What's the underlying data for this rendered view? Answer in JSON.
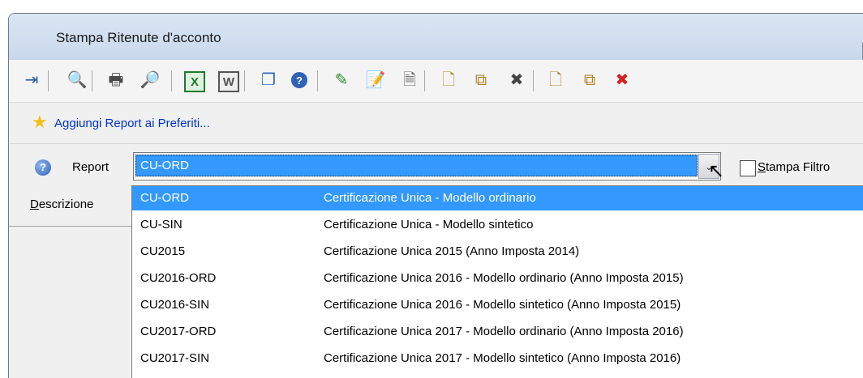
{
  "window": {
    "title": "Stampa Ritenute d'acconto"
  },
  "toolbar": {
    "buttons": [
      {
        "icon": "exit-icon",
        "glyph": "⇥",
        "color": "#2c5fa8"
      },
      {
        "icon": "binoculars-icon",
        "glyph": "🔍",
        "color": "#333333"
      },
      {
        "icon": "print-icon",
        "glyph": "🖶",
        "color": "#4a4a4a"
      },
      {
        "icon": "print-preview-icon",
        "glyph": "🔎",
        "color": "#2d5fa0"
      },
      {
        "icon": "excel-icon",
        "glyph": "X",
        "color": "#1d7a2e"
      },
      {
        "icon": "word-icon",
        "glyph": "W",
        "color": "#555555"
      },
      {
        "icon": "windows-icon",
        "glyph": "❐",
        "color": "#2f6bc4"
      },
      {
        "icon": "help-icon",
        "glyph": "?",
        "color": "#2f62b8"
      },
      {
        "icon": "pencil-icon",
        "glyph": "✎",
        "color": "#2e8b2e"
      },
      {
        "icon": "edit-document-icon",
        "glyph": "📝",
        "color": "#3b7a2f"
      },
      {
        "icon": "document-icon",
        "glyph": "🗎",
        "color": "#666666"
      },
      {
        "icon": "new-icon",
        "glyph": "🗋",
        "color": "#b08a2e"
      },
      {
        "icon": "copy-icon",
        "glyph": "⧉",
        "color": "#b07a1e"
      },
      {
        "icon": "delete-gray-icon",
        "glyph": "✖",
        "color": "#444444"
      },
      {
        "icon": "new-icon-2",
        "glyph": "🗋",
        "color": "#b08a2e"
      },
      {
        "icon": "copy-icon-2",
        "glyph": "⧉",
        "color": "#b07a1e"
      },
      {
        "icon": "delete-red-icon",
        "glyph": "✖",
        "color": "#d62020"
      }
    ]
  },
  "favorites": {
    "star_glyph": "★",
    "label": "Aggiungi Report ai Preferiti..."
  },
  "form": {
    "report_label": "Report",
    "report_icon_glyph": "?",
    "report_value": "CU-ORD",
    "dropdown_glyph": "⌄",
    "cursor_glyph": "↖",
    "descrizione_label": "Descrizione",
    "stampa_filtro_label": "Stampa Filtro"
  },
  "dropdown": {
    "items": [
      {
        "code": "CU-ORD",
        "desc": "Certificazione Unica - Modello ordinario",
        "selected": true
      },
      {
        "code": "CU-SIN",
        "desc": "Certificazione Unica - Modello sintetico",
        "selected": false
      },
      {
        "code": "CU2015",
        "desc": "Certificazione Unica 2015 (Anno Imposta 2014)",
        "selected": false
      },
      {
        "code": "CU2016-ORD",
        "desc": "Certificazione Unica 2016 - Modello ordinario (Anno Imposta 2015)",
        "selected": false
      },
      {
        "code": "CU2016-SIN",
        "desc": "Certificazione Unica 2016 - Modello sintetico (Anno Imposta 2015)",
        "selected": false
      },
      {
        "code": "CU2017-ORD",
        "desc": "Certificazione Unica 2017 - Modello ordinario (Anno Imposta 2016)",
        "selected": false
      },
      {
        "code": "CU2017-SIN",
        "desc": "Certificazione Unica 2017 - Modello sintetico (Anno Imposta 2016)",
        "selected": false
      }
    ]
  },
  "colors": {
    "selection": "#3399ff",
    "link": "#0033cc",
    "star": "#f3c21b"
  }
}
